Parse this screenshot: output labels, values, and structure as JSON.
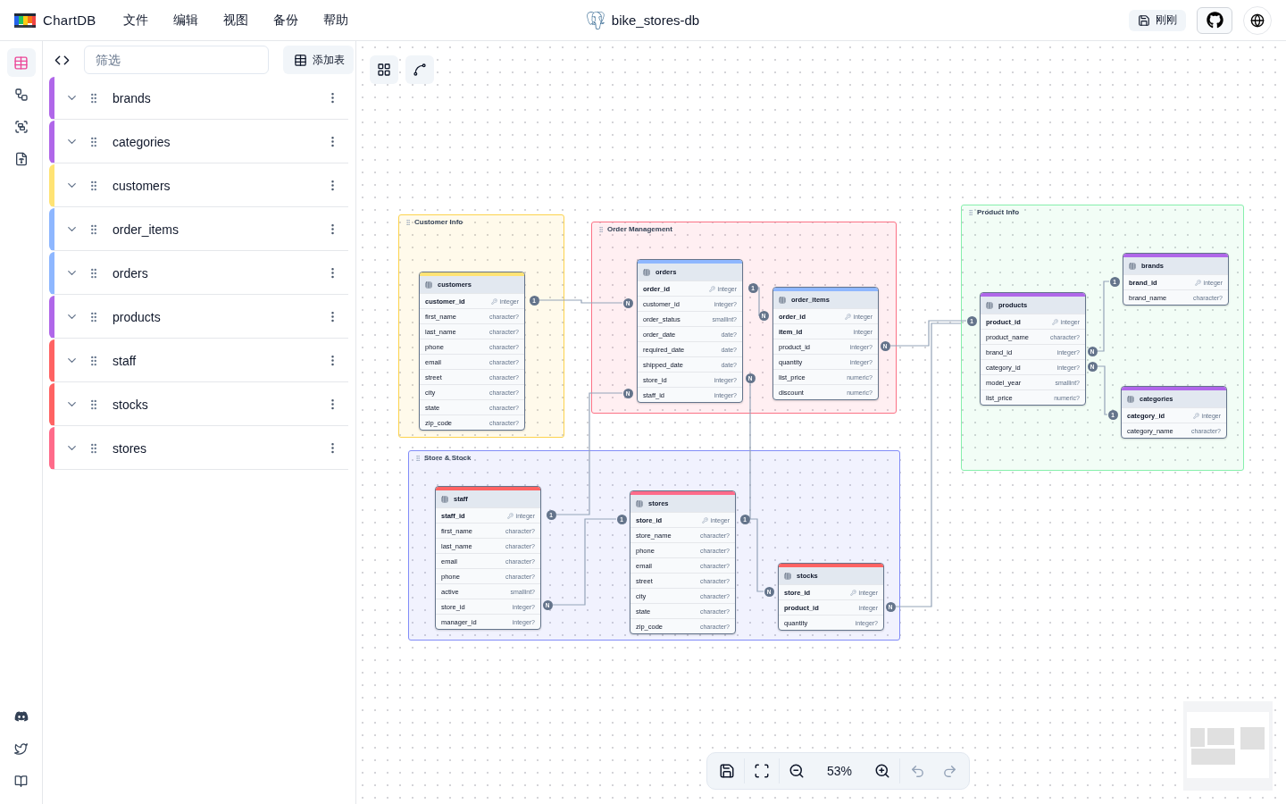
{
  "app": {
    "name": "ChartDB"
  },
  "menu": [
    "文件",
    "编辑",
    "视图",
    "备份",
    "帮助"
  ],
  "diagram": {
    "title": "bike_stores-db"
  },
  "header_actions": {
    "save_status": "刚刚"
  },
  "nav_rail": [
    {
      "kind": "tables",
      "selected": true
    },
    {
      "kind": "relationships",
      "selected": false
    },
    {
      "kind": "areas",
      "selected": false
    },
    {
      "kind": "custom_types",
      "selected": false
    }
  ],
  "sidebar": {
    "filter": {
      "placeholder": "筛选"
    },
    "add_table": "添加表",
    "tables": [
      {
        "name": "brands",
        "color": "#b067e9"
      },
      {
        "name": "categories",
        "color": "#b067e9"
      },
      {
        "name": "customers",
        "color": "#ffe374"
      },
      {
        "name": "order_items",
        "color": "#8eb7ff"
      },
      {
        "name": "orders",
        "color": "#8eb7ff"
      },
      {
        "name": "products",
        "color": "#b067e9"
      },
      {
        "name": "staff",
        "color": "#ff6363"
      },
      {
        "name": "stocks",
        "color": "#ff6363"
      },
      {
        "name": "stores",
        "color": "#ff6b8a"
      }
    ]
  },
  "canvas": {
    "areas": [
      {
        "title": "Customer Info",
        "color": "#fcd34d"
      },
      {
        "title": "Order Management",
        "color": "#fb7185"
      },
      {
        "title": "Product Info",
        "color": "#86efac"
      },
      {
        "title": "Store & Stock",
        "color": "#818cf8"
      }
    ],
    "tables": [
      {
        "name": "customers",
        "color": "#ffe374",
        "columns": [
          {
            "name": "customer_id",
            "type": "integer",
            "pk": true,
            "key": true
          },
          {
            "name": "first_name",
            "type": "character?",
            "pk": false,
            "key": false
          },
          {
            "name": "last_name",
            "type": "character?",
            "pk": false,
            "key": false
          },
          {
            "name": "phone",
            "type": "character?",
            "pk": false,
            "key": false
          },
          {
            "name": "email",
            "type": "character?",
            "pk": false,
            "key": false
          },
          {
            "name": "street",
            "type": "character?",
            "pk": false,
            "key": false
          },
          {
            "name": "city",
            "type": "character?",
            "pk": false,
            "key": false
          },
          {
            "name": "state",
            "type": "character?",
            "pk": false,
            "key": false
          },
          {
            "name": "zip_code",
            "type": "character?",
            "pk": false,
            "key": false
          }
        ]
      },
      {
        "name": "orders",
        "color": "#8eb7ff",
        "columns": [
          {
            "name": "order_id",
            "type": "integer",
            "pk": true,
            "key": true
          },
          {
            "name": "customer_id",
            "type": "integer?",
            "pk": false,
            "key": false
          },
          {
            "name": "order_status",
            "type": "smallint?",
            "pk": false,
            "key": false
          },
          {
            "name": "order_date",
            "type": "date?",
            "pk": false,
            "key": false
          },
          {
            "name": "required_date",
            "type": "date?",
            "pk": false,
            "key": false
          },
          {
            "name": "shipped_date",
            "type": "date?",
            "pk": false,
            "key": false
          },
          {
            "name": "store_id",
            "type": "integer?",
            "pk": false,
            "key": false
          },
          {
            "name": "staff_id",
            "type": "integer?",
            "pk": false,
            "key": false
          }
        ]
      },
      {
        "name": "order_items",
        "color": "#8eb7ff",
        "columns": [
          {
            "name": "order_id",
            "type": "integer",
            "pk": true,
            "key": true
          },
          {
            "name": "item_id",
            "type": "integer",
            "pk": true,
            "key": false
          },
          {
            "name": "product_id",
            "type": "integer?",
            "pk": false,
            "key": false
          },
          {
            "name": "quantity",
            "type": "integer?",
            "pk": false,
            "key": false
          },
          {
            "name": "list_price",
            "type": "numeric?",
            "pk": false,
            "key": false
          },
          {
            "name": "discount",
            "type": "numeric?",
            "pk": false,
            "key": false
          }
        ]
      },
      {
        "name": "products",
        "color": "#b067e9",
        "columns": [
          {
            "name": "product_id",
            "type": "integer",
            "pk": true,
            "key": true
          },
          {
            "name": "product_name",
            "type": "character?",
            "pk": false,
            "key": false
          },
          {
            "name": "brand_id",
            "type": "integer?",
            "pk": false,
            "key": false
          },
          {
            "name": "category_id",
            "type": "integer?",
            "pk": false,
            "key": false
          },
          {
            "name": "model_year",
            "type": "smallint?",
            "pk": false,
            "key": false
          },
          {
            "name": "list_price",
            "type": "numeric?",
            "pk": false,
            "key": false
          }
        ]
      },
      {
        "name": "brands",
        "color": "#b067e9",
        "columns": [
          {
            "name": "brand_id",
            "type": "integer",
            "pk": true,
            "key": true
          },
          {
            "name": "brand_name",
            "type": "character?",
            "pk": false,
            "key": false
          }
        ]
      },
      {
        "name": "categories",
        "color": "#b067e9",
        "columns": [
          {
            "name": "category_id",
            "type": "integer",
            "pk": true,
            "key": true
          },
          {
            "name": "category_name",
            "type": "character?",
            "pk": false,
            "key": false
          }
        ]
      },
      {
        "name": "staff",
        "color": "#ff6363",
        "columns": [
          {
            "name": "staff_id",
            "type": "integer",
            "pk": true,
            "key": true
          },
          {
            "name": "first_name",
            "type": "character?",
            "pk": false,
            "key": false
          },
          {
            "name": "last_name",
            "type": "character?",
            "pk": false,
            "key": false
          },
          {
            "name": "email",
            "type": "character?",
            "pk": false,
            "key": false
          },
          {
            "name": "phone",
            "type": "character?",
            "pk": false,
            "key": false
          },
          {
            "name": "active",
            "type": "smallint?",
            "pk": false,
            "key": false
          },
          {
            "name": "store_id",
            "type": "integer?",
            "pk": false,
            "key": false
          },
          {
            "name": "manager_id",
            "type": "integer?",
            "pk": false,
            "key": false
          }
        ]
      },
      {
        "name": "stores",
        "color": "#ff6b8a",
        "columns": [
          {
            "name": "store_id",
            "type": "integer",
            "pk": true,
            "key": true
          },
          {
            "name": "store_name",
            "type": "character?",
            "pk": false,
            "key": false
          },
          {
            "name": "phone",
            "type": "character?",
            "pk": false,
            "key": false
          },
          {
            "name": "email",
            "type": "character?",
            "pk": false,
            "key": false
          },
          {
            "name": "street",
            "type": "character?",
            "pk": false,
            "key": false
          },
          {
            "name": "city",
            "type": "character?",
            "pk": false,
            "key": false
          },
          {
            "name": "state",
            "type": "character?",
            "pk": false,
            "key": false
          },
          {
            "name": "zip_code",
            "type": "character?",
            "pk": false,
            "key": false
          }
        ]
      },
      {
        "name": "stocks",
        "color": "#ff6363",
        "columns": [
          {
            "name": "store_id",
            "type": "integer",
            "pk": true,
            "key": true
          },
          {
            "name": "product_id",
            "type": "integer",
            "pk": true,
            "key": false
          },
          {
            "name": "quantity",
            "type": "integer?",
            "pk": false,
            "key": false
          }
        ]
      }
    ],
    "relationships": [
      {
        "from_label": "1",
        "to_label": "N"
      },
      {
        "from_label": "1",
        "to_label": "N"
      },
      {
        "from_label": "N",
        "to_label": "1"
      },
      {
        "from_label": "N",
        "to_label": "1"
      },
      {
        "from_label": "N",
        "to_label": "1"
      },
      {
        "from_label": "N",
        "to_label": "1"
      },
      {
        "to_label": "N"
      },
      {
        "from_label": "N"
      },
      {
        "from_label": "N",
        "to_label": "1"
      },
      {
        "from_label": "N",
        "to_label": "1"
      }
    ]
  },
  "toolbar": {
    "zoom": "53%"
  }
}
